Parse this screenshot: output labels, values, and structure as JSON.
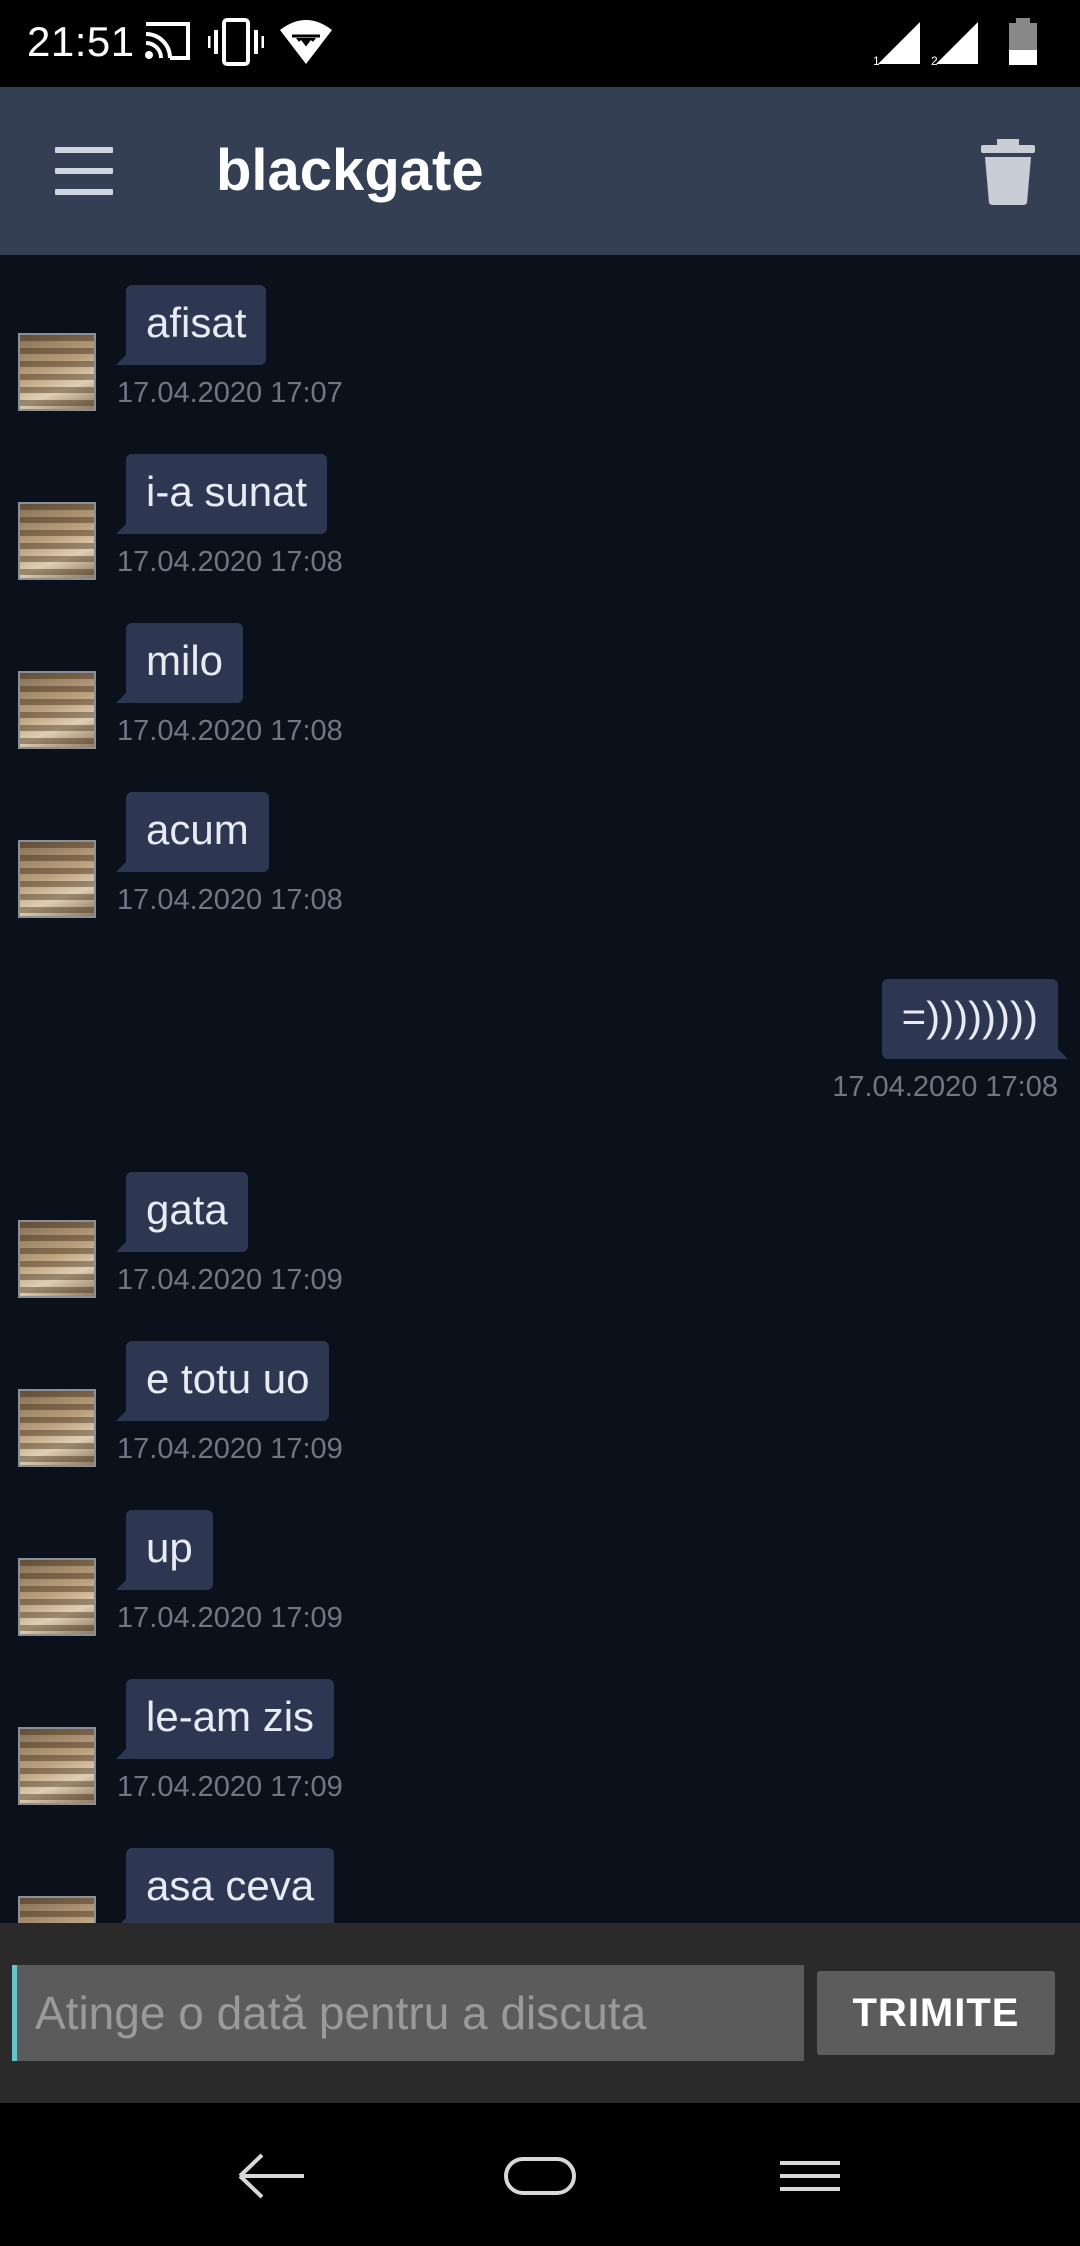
{
  "status_bar": {
    "time": "21:51",
    "icons": [
      "cast-icon",
      "vibrate-icon",
      "wifi-icon",
      "signal-sim1-icon",
      "signal-sim2-icon",
      "battery-icon"
    ],
    "sim1_label": "1",
    "sim2_label": "2"
  },
  "header": {
    "title": "blackgate",
    "background": "#343f53"
  },
  "messages": [
    {
      "text": "afisat",
      "time": "17.04.2020 17:07",
      "direction": "incoming"
    },
    {
      "text": "i-a sunat",
      "time": "17.04.2020 17:08",
      "direction": "incoming"
    },
    {
      "text": "milo",
      "time": "17.04.2020 17:08",
      "direction": "incoming"
    },
    {
      "text": "acum",
      "time": "17.04.2020 17:08",
      "direction": "incoming"
    },
    {
      "text": "=))))))))",
      "time": "17.04.2020 17:08",
      "direction": "outgoing"
    },
    {
      "text": "gata",
      "time": "17.04.2020 17:09",
      "direction": "incoming"
    },
    {
      "text": "e totu uo",
      "time": "17.04.2020 17:09",
      "direction": "incoming"
    },
    {
      "text": "up",
      "time": "17.04.2020 17:09",
      "direction": "incoming"
    },
    {
      "text": "le-am zis",
      "time": "17.04.2020 17:09",
      "direction": "incoming"
    },
    {
      "text": "asa ceva",
      "time": "",
      "direction": "incoming"
    }
  ],
  "composer": {
    "value": "",
    "placeholder": "Atinge o dată pentru a discuta",
    "send_label": "TRIMITE"
  },
  "colors": {
    "background": "#0b111a",
    "bubble": "#2e3751",
    "timestamp": "#6f7785",
    "cursor": "#67c3cc"
  }
}
